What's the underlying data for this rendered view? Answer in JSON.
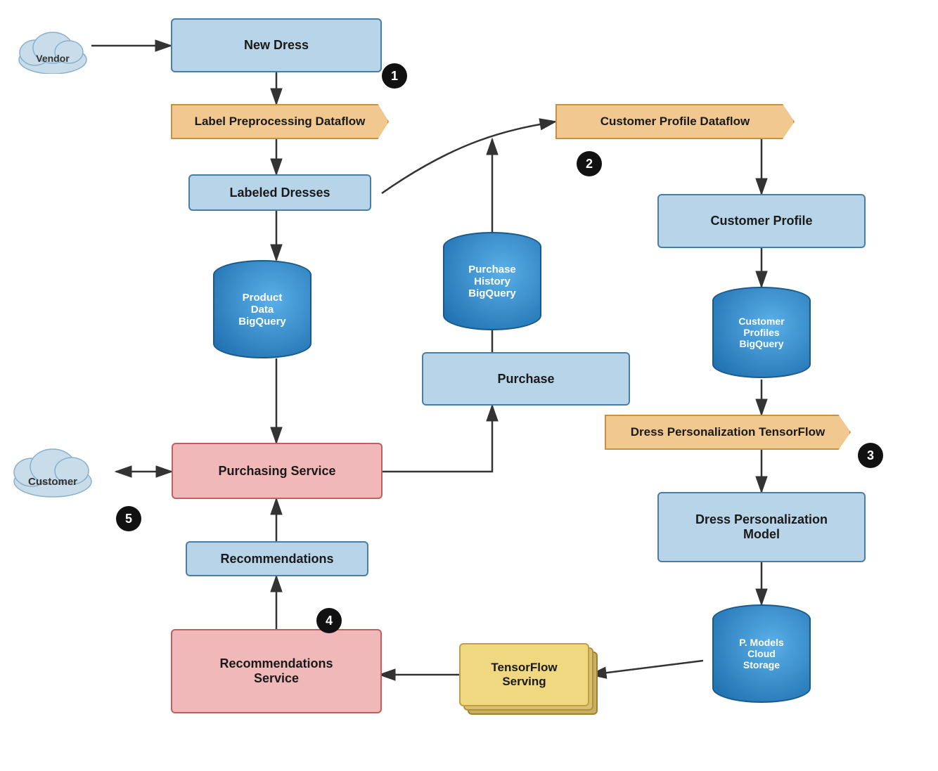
{
  "nodes": {
    "vendor": {
      "label": "Vendor"
    },
    "new_dress": {
      "label": "New Dress"
    },
    "label_preprocessing": {
      "label": "Label Preprocessing Dataflow"
    },
    "labeled_dresses": {
      "label": "Labeled Dresses"
    },
    "product_data_bigquery": {
      "label": "Product\nData\nBigQuery"
    },
    "customer_profile_dataflow": {
      "label": "Customer Profile Dataflow"
    },
    "customer_profile": {
      "label": "Customer Profile"
    },
    "purchase_history_bigquery": {
      "label": "Purchase\nHistory\nBigQuery"
    },
    "customer_profiles_bigquery": {
      "label": "Customer\nProfiles\nBigQuery"
    },
    "purchase": {
      "label": "Purchase"
    },
    "purchasing_service": {
      "label": "Purchasing Service"
    },
    "customer": {
      "label": "Customer"
    },
    "dress_personalization_tensorflow": {
      "label": "Dress Personalization TensorFlow"
    },
    "dress_personalization_model": {
      "label": "Dress Personalization\nModel"
    },
    "p_models_cloud_storage": {
      "label": "P. Models\nCloud\nStorage"
    },
    "tensorflow_serving": {
      "label": "TensorFlow\nServing"
    },
    "recommendations": {
      "label": "Recommendations"
    },
    "recommendations_service": {
      "label": "Recommendations\nService"
    }
  },
  "badges": {
    "b1": "1",
    "b2": "2",
    "b3": "3",
    "b4": "4",
    "b5": "5"
  }
}
